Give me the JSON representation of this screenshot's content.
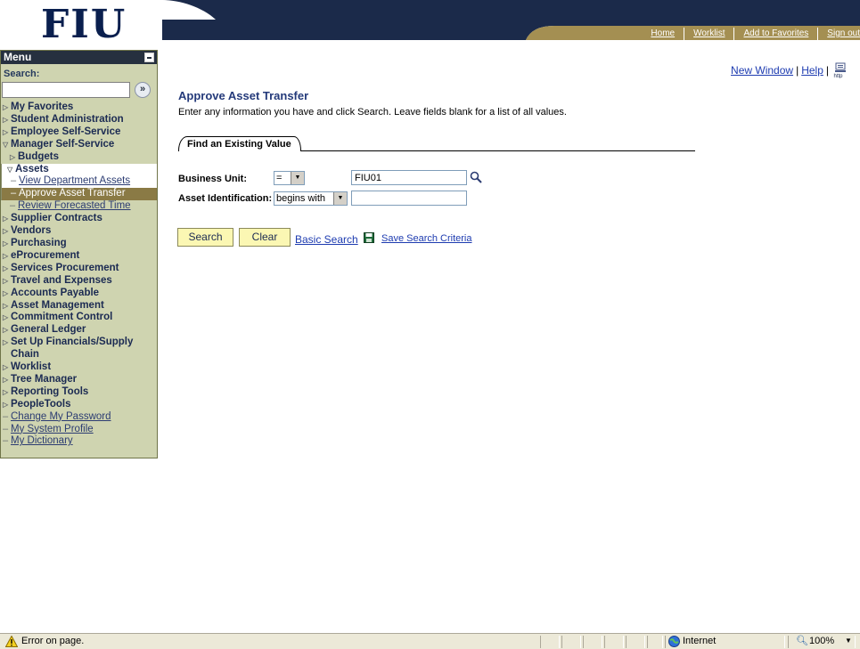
{
  "header": {
    "logo": "FIU",
    "links": [
      "Home",
      "Worklist",
      "Add to Favorites",
      "Sign out"
    ]
  },
  "sidebar": {
    "title": "Menu",
    "search_label": "Search:",
    "search_value": "",
    "items": [
      {
        "label": "My Favorites"
      },
      {
        "label": "Student Administration"
      },
      {
        "label": "Employee Self-Service"
      },
      {
        "label": "Manager Self-Service"
      },
      {
        "label": "Budgets"
      },
      {
        "label": "Assets"
      },
      {
        "label": "View Department Assets"
      },
      {
        "label": "Approve Asset Transfer"
      },
      {
        "label": "Review Forecasted Time"
      },
      {
        "label": "Supplier Contracts"
      },
      {
        "label": "Vendors"
      },
      {
        "label": "Purchasing"
      },
      {
        "label": "eProcurement"
      },
      {
        "label": "Services Procurement"
      },
      {
        "label": "Travel and Expenses"
      },
      {
        "label": "Accounts Payable"
      },
      {
        "label": "Asset Management"
      },
      {
        "label": "Commitment Control"
      },
      {
        "label": "General Ledger"
      },
      {
        "label": "Set Up Financials/Supply Chain"
      },
      {
        "label": "Worklist"
      },
      {
        "label": "Tree Manager"
      },
      {
        "label": "Reporting Tools"
      },
      {
        "label": "PeopleTools"
      },
      {
        "label": "Change My Password"
      },
      {
        "label": "My System Profile"
      },
      {
        "label": "My Dictionary"
      }
    ]
  },
  "toplinks": {
    "new_window": "New Window",
    "help": "Help"
  },
  "page": {
    "title": "Approve Asset Transfer",
    "instructions": "Enter any information you have and click Search. Leave fields blank for a list of all values.",
    "tab": "Find an Existing Value",
    "business_unit_label": "Business Unit:",
    "business_unit_operator": "=",
    "business_unit_value": "FIU01",
    "asset_id_label": "Asset Identification:",
    "asset_id_operator": "begins with",
    "asset_id_value": "",
    "search_button": "Search",
    "clear_button": "Clear",
    "basic_search": "Basic Search",
    "save_search": "Save Search Criteria"
  },
  "statusbar": {
    "message": "Error on page.",
    "zone": "Internet",
    "zoom": "100%"
  },
  "colors": {
    "menu_bg": "#cfd4b0",
    "menu_header": "#26303f",
    "active_item": "#8a7a45",
    "banner_navy": "#1b2a4a",
    "banner_gold": "#a48f52",
    "button_bg": "#fbf7b3"
  }
}
